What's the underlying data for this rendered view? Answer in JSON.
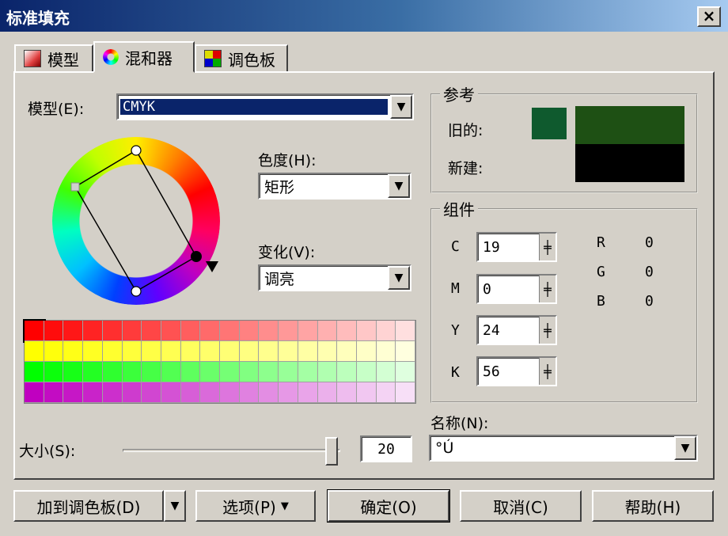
{
  "window": {
    "title": "标准填充",
    "close": "×"
  },
  "tabs": [
    {
      "label": "模型"
    },
    {
      "label": "混和器"
    },
    {
      "label": "调色板"
    }
  ],
  "model": {
    "label": "模型(E):",
    "value": "CMYK"
  },
  "hue": {
    "label": "色度(H):",
    "value": "矩形"
  },
  "variation": {
    "label": "变化(V):",
    "value": "调亮"
  },
  "reference": {
    "title": "参考",
    "old_label": "旧的:",
    "new_label": "新建:",
    "old_colors": [
      "#0f5a2e",
      "#1e5014"
    ],
    "new_color": "#000000"
  },
  "components": {
    "title": "组件",
    "cmyk": [
      {
        "label": "C",
        "value": "19"
      },
      {
        "label": "M",
        "value": "0"
      },
      {
        "label": "Y",
        "value": "24"
      },
      {
        "label": "K",
        "value": "56"
      }
    ],
    "rgb": [
      {
        "label": "R",
        "value": "0"
      },
      {
        "label": "G",
        "value": "0"
      },
      {
        "label": "B",
        "value": "0"
      }
    ]
  },
  "name": {
    "label": "名称(N):",
    "value": "°Ú"
  },
  "size": {
    "label": "大小(S):",
    "value": "20",
    "slider_fraction": 0.99
  },
  "palette_rows": [
    "#ff0000",
    "#ffff00",
    "#00ff00",
    "#c000c0"
  ],
  "buttons": {
    "add_palette": "加到调色板(D)",
    "options": "选项(P)",
    "ok": "确定(O)",
    "cancel": "取消(C)",
    "help": "帮助(H)"
  }
}
